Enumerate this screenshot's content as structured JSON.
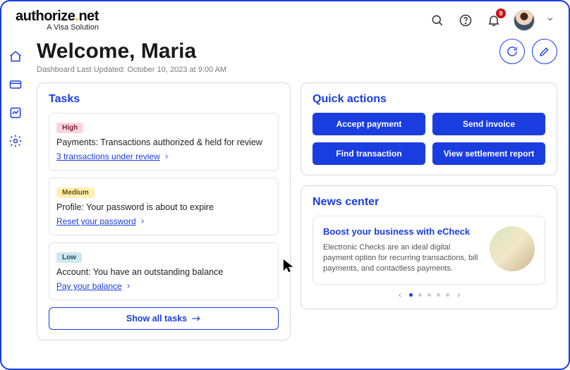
{
  "brand": {
    "name_left": "authorize",
    "name_right": "net",
    "tagline": "A Visa Solution"
  },
  "notifications": {
    "count": "9"
  },
  "sidenav": {
    "items": [
      {
        "name": "home-icon"
      },
      {
        "name": "card-icon"
      },
      {
        "name": "report-icon"
      },
      {
        "name": "settings-gear-icon"
      }
    ]
  },
  "header": {
    "welcome": "Welcome, Maria",
    "updated": "Dashboard Last Updated: October 10, 2023 at 9:00 AM"
  },
  "tasks": {
    "title": "Tasks",
    "items": [
      {
        "priority": "High",
        "text": "Payments: Transactions authorized & held for review",
        "link": "3 transactions under review"
      },
      {
        "priority": "Medium",
        "text": "Profile: Your password is about to expire",
        "link": "Reset your password"
      },
      {
        "priority": "Low",
        "text": "Account: You have an outstanding balance",
        "link": "Pay your balance"
      }
    ],
    "show_all": "Show all tasks"
  },
  "quick_actions": {
    "title": "Quick actions",
    "buttons": [
      "Accept payment",
      "Send invoice",
      "Find transaction",
      "View settlement report"
    ]
  },
  "news": {
    "title": "News center",
    "card": {
      "headline": "Boost your business with eCheck",
      "body": "Electronic Checks are an ideal digital payment option for recurring transactions, bill payments, and contactless payments."
    },
    "slides": 5,
    "active": 0
  }
}
